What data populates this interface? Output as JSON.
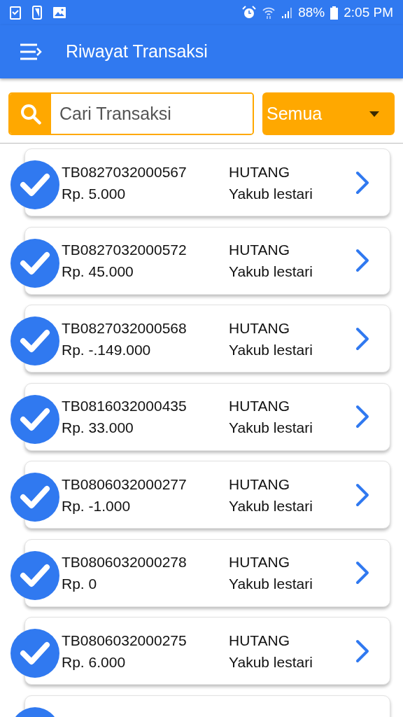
{
  "status_bar": {
    "battery": "88%",
    "time": "2:05 PM"
  },
  "header": {
    "title": "Riwayat Transaksi"
  },
  "search": {
    "placeholder": "Cari Transaksi"
  },
  "filter": {
    "value": "Semua"
  },
  "transactions": [
    {
      "kind": "full",
      "checked": true,
      "code": "TB0827032000567",
      "amount": "Rp. 5.000",
      "type": "HUTANG",
      "name": "Yakub lestari"
    },
    {
      "kind": "full",
      "checked": true,
      "code": "TB0827032000572",
      "amount": "Rp. 45.000",
      "type": "HUTANG",
      "name": "Yakub lestari"
    },
    {
      "kind": "full",
      "checked": true,
      "code": "TB0827032000568",
      "amount": "Rp. -.149.000",
      "type": "HUTANG",
      "name": "Yakub lestari"
    },
    {
      "kind": "full",
      "checked": true,
      "code": "TB0816032000435",
      "amount": "Rp. 33.000",
      "type": "HUTANG",
      "name": "Yakub lestari"
    },
    {
      "kind": "full",
      "checked": true,
      "code": "TB0806032000277",
      "amount": "Rp. -1.000",
      "type": "HUTANG",
      "name": "Yakub lestari"
    },
    {
      "kind": "full",
      "checked": true,
      "code": "TB0806032000278",
      "amount": "Rp. 0",
      "type": "HUTANG",
      "name": "Yakub lestari"
    },
    {
      "kind": "full",
      "checked": true,
      "code": "TB0806032000275",
      "amount": "Rp. 6.000",
      "type": "HUTANG",
      "name": "Yakub lestari"
    },
    {
      "kind": "partial",
      "checked": true
    }
  ]
}
